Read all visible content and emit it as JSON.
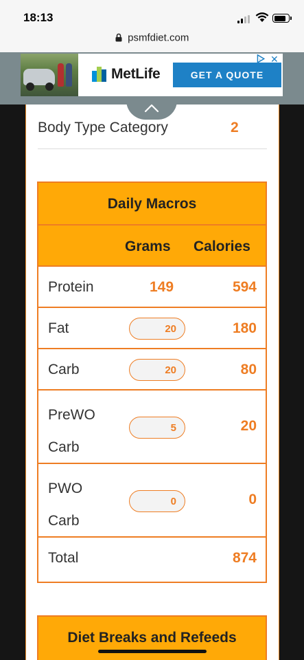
{
  "status_bar": {
    "time": "18:13"
  },
  "browser": {
    "url": "psmfdiet.com"
  },
  "ad": {
    "brand": "MetLife",
    "cta": "GET A QUOTE",
    "close": "✕",
    "brand_color": "#1e81c6"
  },
  "body_type": {
    "label": "Body Type Category",
    "value": "2"
  },
  "macros": {
    "title": "Daily Macros",
    "col_grams": "Grams",
    "col_calories": "Calories",
    "rows": [
      {
        "label": "Protein",
        "grams": "149",
        "calories": "594"
      },
      {
        "label": "Fat",
        "grams": "20",
        "calories": "180"
      },
      {
        "label": "Carb",
        "grams": "20",
        "calories": "80"
      },
      {
        "label_line1": "PreWO",
        "label_line2": "Carb",
        "grams": "5",
        "calories": "20"
      },
      {
        "label_line1": "PWO",
        "label_line2": "Carb",
        "grams": "0",
        "calories": "0"
      },
      {
        "label": "Total",
        "calories": "874"
      }
    ],
    "accent_color": "#ee7d23",
    "header_color": "#ffa907"
  },
  "diet_breaks": {
    "title": "Diet Breaks and Refeeds"
  }
}
